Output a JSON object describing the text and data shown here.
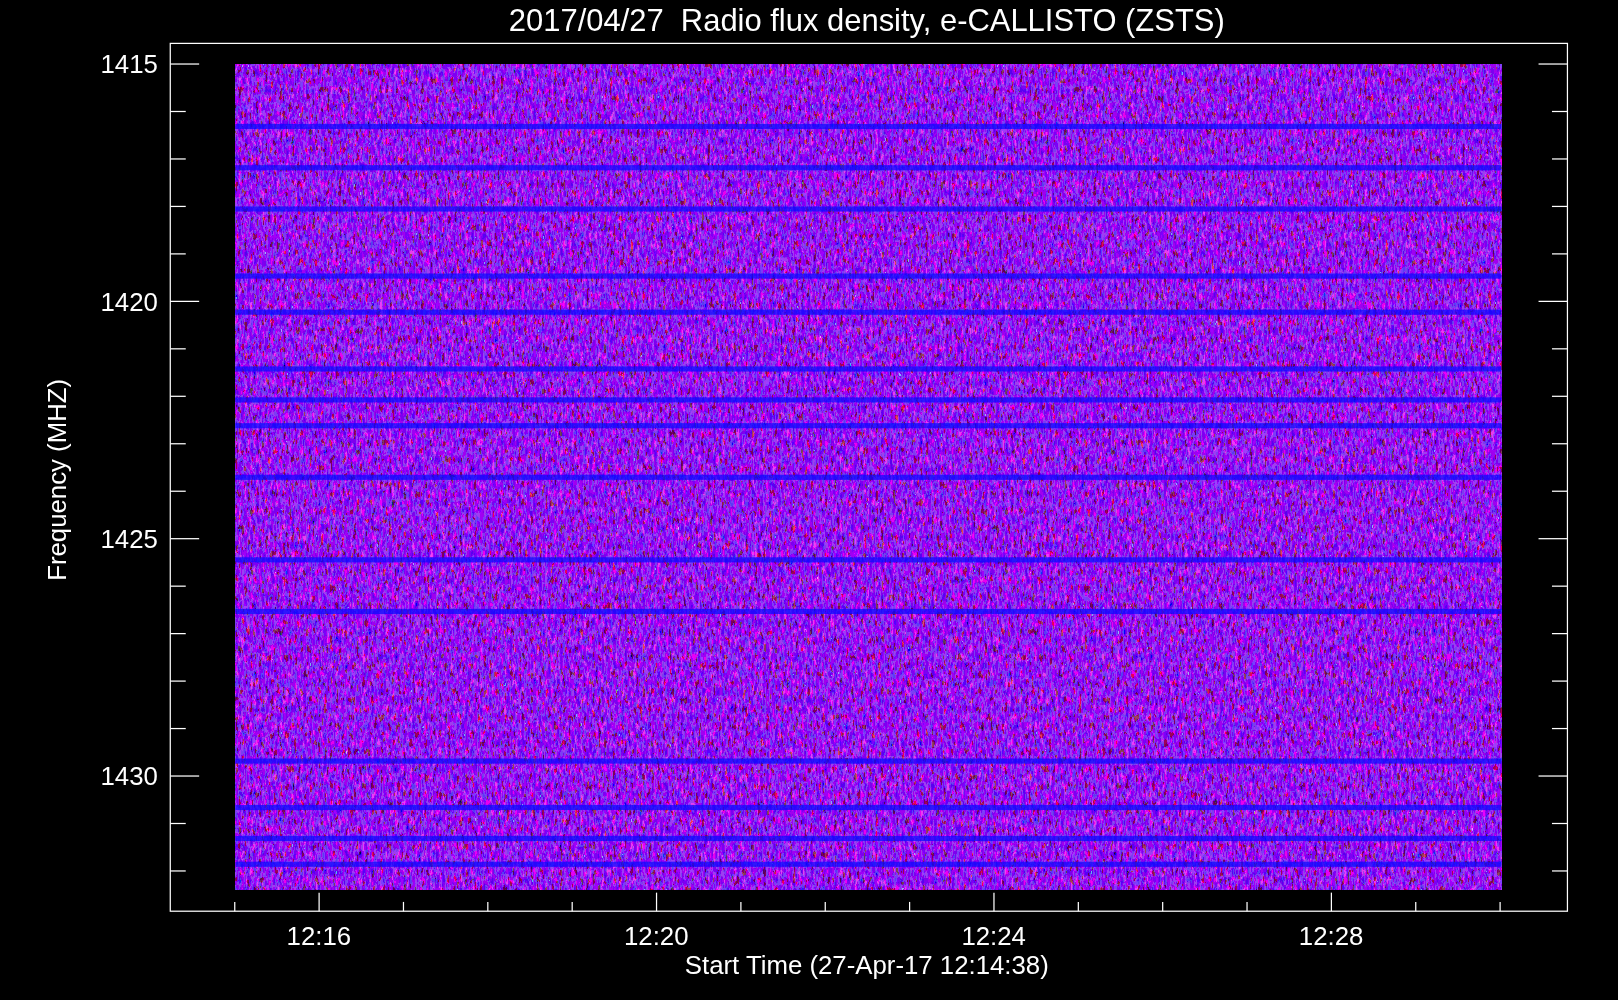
{
  "plot": {
    "title": "2017/04/27  Radio flux density, e-CALLISTO (ZSTS)",
    "x_axis": {
      "label": "Start Time (27-Apr-17 12:14:38)",
      "ticks": [
        "12:16",
        "12:20",
        "12:24",
        "12:28"
      ]
    },
    "y_axis": {
      "label": "Frequency (MHZ)",
      "ticks": [
        "1415",
        "1420",
        "1425",
        "1430"
      ]
    }
  }
}
